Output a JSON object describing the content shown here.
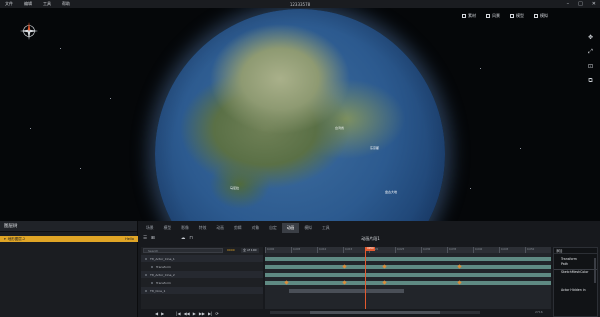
{
  "app": {
    "title": "12333578",
    "menu": [
      "文件",
      "编辑",
      "工具",
      "帮助"
    ],
    "window_controls": [
      "–",
      "□",
      "✕"
    ]
  },
  "viewport": {
    "toolbar": [
      {
        "label": "素材",
        "icon": "image-icon"
      },
      {
        "label": "风景",
        "icon": "landscape-icon"
      },
      {
        "label": "模型",
        "icon": "model-icon"
      },
      {
        "label": "模拟",
        "icon": "simulation-icon"
      }
    ],
    "side_tools": [
      "✥",
      "⤢",
      "⊡",
      "⧉"
    ],
    "geo_labels": [
      "台湾省",
      "东京都",
      "马尼拉",
      "盘古大地"
    ]
  },
  "scene_tree": {
    "title": "图层树",
    "selected_item": {
      "name": "地形图层-2",
      "extra": "Hello"
    }
  },
  "tabs": [
    "场景",
    "模型",
    "影像",
    "特效",
    "动画",
    "剪辑",
    "对象",
    "自定",
    "动画",
    "模拟",
    "工具"
  ],
  "active_tab_index": 8,
  "timeline": {
    "title": "动画片段1",
    "search_placeholder": "Search",
    "start_frame": "0000",
    "frame_count": "全 of 100",
    "tracks": [
      {
        "label": "Ttl_Actor_Cine_1",
        "type": "group"
      },
      {
        "label": "Transform",
        "type": "child"
      },
      {
        "label": "Ttl_Actor_Cine_2",
        "type": "group"
      },
      {
        "label": "Transform",
        "type": "child"
      },
      {
        "label": "Ttl_Cine_1",
        "type": "group"
      }
    ],
    "ruler_ticks": [
      "0,000",
      "0,005",
      "0,010",
      "0,015",
      "0,020",
      "0,025",
      "0,030",
      "0,035",
      "0,040",
      "0,045",
      "0,050"
    ],
    "playhead_label": "0050",
    "playhead_frame": 0.35,
    "start_readout": "-172",
    "end_readout": "2716"
  },
  "context_menu": {
    "title": "添加",
    "items": [
      "Transform",
      "Path",
      "SketchMeshColor",
      "Actor Hidden in"
    ]
  },
  "colors": {
    "accent": "#e0a526",
    "playhead": "#e35a2f",
    "keyframe": "#d98d3a",
    "track_bar": "#5f8a83"
  }
}
